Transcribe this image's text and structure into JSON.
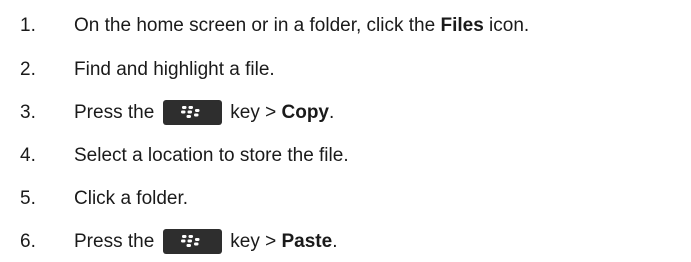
{
  "steps": [
    {
      "number": "1.",
      "pre": "On the home screen or in a folder, click the ",
      "bold": "Files",
      "post": " icon."
    },
    {
      "number": "2.",
      "text": "Find and highlight a file."
    },
    {
      "number": "3.",
      "pre": "Press the",
      "key_icon": "blackberry-menu-key-icon",
      "mid": "key > ",
      "bold": "Copy",
      "post": "."
    },
    {
      "number": "4.",
      "text": "Select a location to store the file."
    },
    {
      "number": "5.",
      "text": "Click a folder."
    },
    {
      "number": "6.",
      "pre": "Press the",
      "key_icon": "blackberry-menu-key-icon",
      "mid": "key > ",
      "bold": "Paste",
      "post": "."
    }
  ],
  "colors": {
    "text": "#1a1a1a",
    "keycap_bg": "#2e2e2e",
    "keycap_glyph": "#ffffff"
  }
}
